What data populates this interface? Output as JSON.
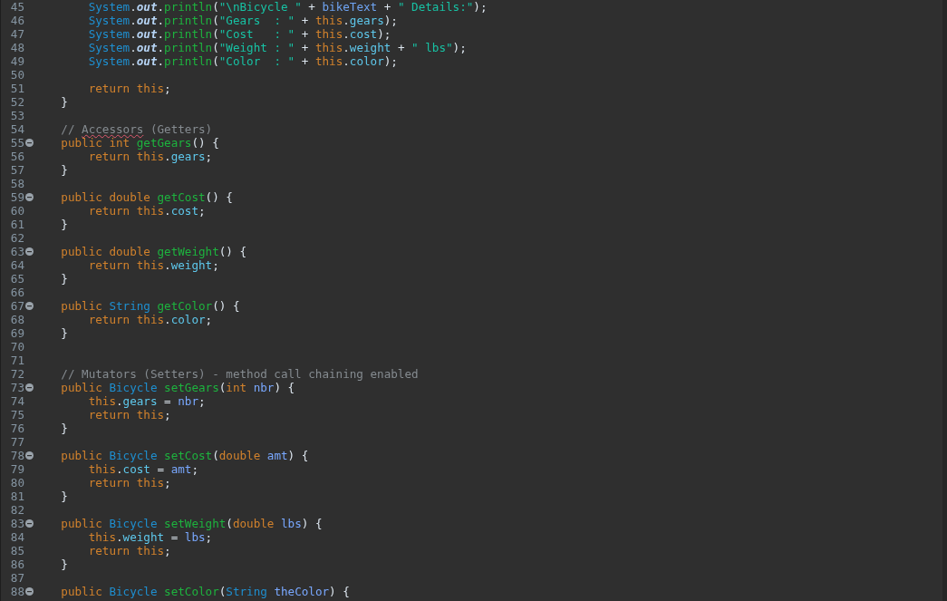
{
  "editor": {
    "lines": [
      {
        "number": "45",
        "foldable": false,
        "tokens": [
          {
            "kind": "type",
            "text": "        System"
          },
          {
            "kind": "plain",
            "text": "."
          },
          {
            "kind": "static",
            "text": "out"
          },
          {
            "kind": "plain",
            "text": "."
          },
          {
            "kind": "method",
            "text": "println"
          },
          {
            "kind": "plain",
            "text": "("
          },
          {
            "kind": "str",
            "text": "\"\\nBicycle \""
          },
          {
            "kind": "plain",
            "text": " + "
          },
          {
            "kind": "var",
            "text": "bikeText"
          },
          {
            "kind": "plain",
            "text": " + "
          },
          {
            "kind": "str",
            "text": "\" Details:\""
          },
          {
            "kind": "plain",
            "text": ");"
          }
        ]
      },
      {
        "number": "46",
        "foldable": false,
        "tokens": [
          {
            "kind": "type",
            "text": "        System"
          },
          {
            "kind": "plain",
            "text": "."
          },
          {
            "kind": "static",
            "text": "out"
          },
          {
            "kind": "plain",
            "text": "."
          },
          {
            "kind": "method",
            "text": "println"
          },
          {
            "kind": "plain",
            "text": "("
          },
          {
            "kind": "str",
            "text": "\"Gears  : \""
          },
          {
            "kind": "plain",
            "text": " + "
          },
          {
            "kind": "kw",
            "text": "this"
          },
          {
            "kind": "plain",
            "text": "."
          },
          {
            "kind": "field",
            "text": "gears"
          },
          {
            "kind": "plain",
            "text": ");"
          }
        ]
      },
      {
        "number": "47",
        "foldable": false,
        "tokens": [
          {
            "kind": "type",
            "text": "        System"
          },
          {
            "kind": "plain",
            "text": "."
          },
          {
            "kind": "static",
            "text": "out"
          },
          {
            "kind": "plain",
            "text": "."
          },
          {
            "kind": "method",
            "text": "println"
          },
          {
            "kind": "plain",
            "text": "("
          },
          {
            "kind": "str",
            "text": "\"Cost   : \""
          },
          {
            "kind": "plain",
            "text": " + "
          },
          {
            "kind": "kw",
            "text": "this"
          },
          {
            "kind": "plain",
            "text": "."
          },
          {
            "kind": "field",
            "text": "cost"
          },
          {
            "kind": "plain",
            "text": ");"
          }
        ]
      },
      {
        "number": "48",
        "foldable": false,
        "tokens": [
          {
            "kind": "type",
            "text": "        System"
          },
          {
            "kind": "plain",
            "text": "."
          },
          {
            "kind": "static",
            "text": "out"
          },
          {
            "kind": "plain",
            "text": "."
          },
          {
            "kind": "method",
            "text": "println"
          },
          {
            "kind": "plain",
            "text": "("
          },
          {
            "kind": "str",
            "text": "\"Weight : \""
          },
          {
            "kind": "plain",
            "text": " + "
          },
          {
            "kind": "kw",
            "text": "this"
          },
          {
            "kind": "plain",
            "text": "."
          },
          {
            "kind": "field",
            "text": "weight"
          },
          {
            "kind": "plain",
            "text": " + "
          },
          {
            "kind": "str",
            "text": "\" lbs\""
          },
          {
            "kind": "plain",
            "text": ");"
          }
        ]
      },
      {
        "number": "49",
        "foldable": false,
        "tokens": [
          {
            "kind": "type",
            "text": "        System"
          },
          {
            "kind": "plain",
            "text": "."
          },
          {
            "kind": "static",
            "text": "out"
          },
          {
            "kind": "plain",
            "text": "."
          },
          {
            "kind": "method",
            "text": "println"
          },
          {
            "kind": "plain",
            "text": "("
          },
          {
            "kind": "str",
            "text": "\"Color  : \""
          },
          {
            "kind": "plain",
            "text": " + "
          },
          {
            "kind": "kw",
            "text": "this"
          },
          {
            "kind": "plain",
            "text": "."
          },
          {
            "kind": "field",
            "text": "color"
          },
          {
            "kind": "plain",
            "text": ");"
          }
        ]
      },
      {
        "number": "50",
        "foldable": false
      },
      {
        "number": "51",
        "foldable": false,
        "tokens": [
          {
            "kind": "kw",
            "text": "        return"
          },
          {
            "kind": "kw",
            "text": " this"
          },
          {
            "kind": "plain",
            "text": ";"
          }
        ]
      },
      {
        "number": "52",
        "foldable": false,
        "tokens": [
          {
            "kind": "plain",
            "text": "    }"
          }
        ]
      },
      {
        "number": "53",
        "foldable": false
      },
      {
        "number": "54",
        "foldable": false,
        "tokens": [
          {
            "kind": "comment",
            "text": "    // "
          },
          {
            "kind": "squiggle",
            "text": "Accessors"
          },
          {
            "kind": "comment",
            "text": " (Getters)"
          }
        ]
      },
      {
        "number": "55",
        "foldable": true,
        "tokens": [
          {
            "kind": "kw",
            "text": "    public"
          },
          {
            "kind": "kw",
            "text": " int"
          },
          {
            "kind": "method",
            "text": " getGears"
          },
          {
            "kind": "plain",
            "text": "() {"
          }
        ]
      },
      {
        "number": "56",
        "foldable": false,
        "tokens": [
          {
            "kind": "kw",
            "text": "        return"
          },
          {
            "kind": "kw",
            "text": " this"
          },
          {
            "kind": "plain",
            "text": "."
          },
          {
            "kind": "field",
            "text": "gears"
          },
          {
            "kind": "plain",
            "text": ";"
          }
        ]
      },
      {
        "number": "57",
        "foldable": false,
        "tokens": [
          {
            "kind": "plain",
            "text": "    }"
          }
        ]
      },
      {
        "number": "58",
        "foldable": false
      },
      {
        "number": "59",
        "foldable": true,
        "tokens": [
          {
            "kind": "kw",
            "text": "    public"
          },
          {
            "kind": "kw",
            "text": " double"
          },
          {
            "kind": "method",
            "text": " getCost"
          },
          {
            "kind": "plain",
            "text": "() {"
          }
        ]
      },
      {
        "number": "60",
        "foldable": false,
        "tokens": [
          {
            "kind": "kw",
            "text": "        return"
          },
          {
            "kind": "kw",
            "text": " this"
          },
          {
            "kind": "plain",
            "text": "."
          },
          {
            "kind": "field",
            "text": "cost"
          },
          {
            "kind": "plain",
            "text": ";"
          }
        ]
      },
      {
        "number": "61",
        "foldable": false,
        "tokens": [
          {
            "kind": "plain",
            "text": "    }"
          }
        ]
      },
      {
        "number": "62",
        "foldable": false
      },
      {
        "number": "63",
        "foldable": true,
        "tokens": [
          {
            "kind": "kw",
            "text": "    public"
          },
          {
            "kind": "kw",
            "text": " double"
          },
          {
            "kind": "method",
            "text": " getWeight"
          },
          {
            "kind": "plain",
            "text": "() {"
          }
        ]
      },
      {
        "number": "64",
        "foldable": false,
        "tokens": [
          {
            "kind": "kw",
            "text": "        return"
          },
          {
            "kind": "kw",
            "text": " this"
          },
          {
            "kind": "plain",
            "text": "."
          },
          {
            "kind": "field",
            "text": "weight"
          },
          {
            "kind": "plain",
            "text": ";"
          }
        ]
      },
      {
        "number": "65",
        "foldable": false,
        "tokens": [
          {
            "kind": "plain",
            "text": "    }"
          }
        ]
      },
      {
        "number": "66",
        "foldable": false
      },
      {
        "number": "67",
        "foldable": true,
        "tokens": [
          {
            "kind": "kw",
            "text": "    public"
          },
          {
            "kind": "type",
            "text": " String"
          },
          {
            "kind": "method",
            "text": " getColor"
          },
          {
            "kind": "plain",
            "text": "() {"
          }
        ]
      },
      {
        "number": "68",
        "foldable": false,
        "tokens": [
          {
            "kind": "kw",
            "text": "        return"
          },
          {
            "kind": "kw",
            "text": " this"
          },
          {
            "kind": "plain",
            "text": "."
          },
          {
            "kind": "field",
            "text": "color"
          },
          {
            "kind": "plain",
            "text": ";"
          }
        ]
      },
      {
        "number": "69",
        "foldable": false,
        "tokens": [
          {
            "kind": "plain",
            "text": "    }"
          }
        ]
      },
      {
        "number": "70",
        "foldable": false
      },
      {
        "number": "71",
        "foldable": false
      },
      {
        "number": "72",
        "foldable": false,
        "tokens": [
          {
            "kind": "comment",
            "text": "    // Mutators (Setters) - method call chaining enabled"
          }
        ]
      },
      {
        "number": "73",
        "foldable": true,
        "tokens": [
          {
            "kind": "kw",
            "text": "    public"
          },
          {
            "kind": "type",
            "text": " Bicycle"
          },
          {
            "kind": "method",
            "text": " setGears"
          },
          {
            "kind": "plain",
            "text": "("
          },
          {
            "kind": "kw",
            "text": "int"
          },
          {
            "kind": "param",
            "text": " nbr"
          },
          {
            "kind": "plain",
            "text": ") {"
          }
        ]
      },
      {
        "number": "74",
        "foldable": false,
        "tokens": [
          {
            "kind": "kw",
            "text": "        this"
          },
          {
            "kind": "plain",
            "text": "."
          },
          {
            "kind": "field",
            "text": "gears"
          },
          {
            "kind": "plain",
            "text": " = "
          },
          {
            "kind": "param",
            "text": "nbr"
          },
          {
            "kind": "plain",
            "text": ";"
          }
        ]
      },
      {
        "number": "75",
        "foldable": false,
        "tokens": [
          {
            "kind": "kw",
            "text": "        return"
          },
          {
            "kind": "kw",
            "text": " this"
          },
          {
            "kind": "plain",
            "text": ";"
          }
        ]
      },
      {
        "number": "76",
        "foldable": false,
        "tokens": [
          {
            "kind": "plain",
            "text": "    }"
          }
        ]
      },
      {
        "number": "77",
        "foldable": false
      },
      {
        "number": "78",
        "foldable": true,
        "tokens": [
          {
            "kind": "kw",
            "text": "    public"
          },
          {
            "kind": "type",
            "text": " Bicycle"
          },
          {
            "kind": "method",
            "text": " setCost"
          },
          {
            "kind": "plain",
            "text": "("
          },
          {
            "kind": "kw",
            "text": "double"
          },
          {
            "kind": "param",
            "text": " amt"
          },
          {
            "kind": "plain",
            "text": ") {"
          }
        ]
      },
      {
        "number": "79",
        "foldable": false,
        "tokens": [
          {
            "kind": "kw",
            "text": "        this"
          },
          {
            "kind": "plain",
            "text": "."
          },
          {
            "kind": "field",
            "text": "cost"
          },
          {
            "kind": "plain",
            "text": " = "
          },
          {
            "kind": "param",
            "text": "amt"
          },
          {
            "kind": "plain",
            "text": ";"
          }
        ]
      },
      {
        "number": "80",
        "foldable": false,
        "tokens": [
          {
            "kind": "kw",
            "text": "        return"
          },
          {
            "kind": "kw",
            "text": " this"
          },
          {
            "kind": "plain",
            "text": ";"
          }
        ]
      },
      {
        "number": "81",
        "foldable": false,
        "tokens": [
          {
            "kind": "plain",
            "text": "    }"
          }
        ]
      },
      {
        "number": "82",
        "foldable": false
      },
      {
        "number": "83",
        "foldable": true,
        "tokens": [
          {
            "kind": "kw",
            "text": "    public"
          },
          {
            "kind": "type",
            "text": " Bicycle"
          },
          {
            "kind": "method",
            "text": " setWeight"
          },
          {
            "kind": "plain",
            "text": "("
          },
          {
            "kind": "kw",
            "text": "double"
          },
          {
            "kind": "param",
            "text": " lbs"
          },
          {
            "kind": "plain",
            "text": ") {"
          }
        ]
      },
      {
        "number": "84",
        "foldable": false,
        "tokens": [
          {
            "kind": "kw",
            "text": "        this"
          },
          {
            "kind": "plain",
            "text": "."
          },
          {
            "kind": "field",
            "text": "weight"
          },
          {
            "kind": "plain",
            "text": " = "
          },
          {
            "kind": "param",
            "text": "lbs"
          },
          {
            "kind": "plain",
            "text": ";"
          }
        ]
      },
      {
        "number": "85",
        "foldable": false,
        "tokens": [
          {
            "kind": "kw",
            "text": "        return"
          },
          {
            "kind": "kw",
            "text": " this"
          },
          {
            "kind": "plain",
            "text": ";"
          }
        ]
      },
      {
        "number": "86",
        "foldable": false,
        "tokens": [
          {
            "kind": "plain",
            "text": "    }"
          }
        ]
      },
      {
        "number": "87",
        "foldable": false
      },
      {
        "number": "88",
        "foldable": true,
        "tokens": [
          {
            "kind": "kw",
            "text": "    public"
          },
          {
            "kind": "type",
            "text": " Bicycle"
          },
          {
            "kind": "method",
            "text": " setColor"
          },
          {
            "kind": "plain",
            "text": "("
          },
          {
            "kind": "type",
            "text": "String"
          },
          {
            "kind": "param",
            "text": " theColor"
          },
          {
            "kind": "plain",
            "text": ") {"
          }
        ]
      }
    ]
  }
}
